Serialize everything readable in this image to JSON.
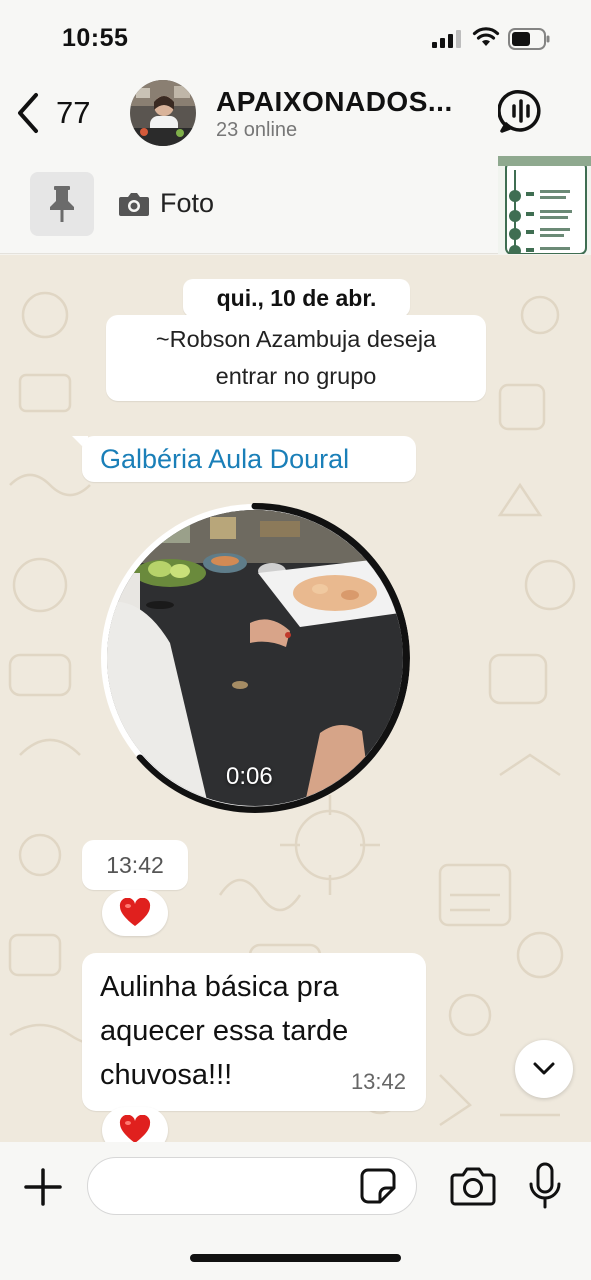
{
  "status_bar": {
    "time": "10:55"
  },
  "header": {
    "back_count": "77",
    "group_name": "APAIXONADOS...",
    "online_status": "23 online"
  },
  "pinned": {
    "label": "Foto"
  },
  "chat": {
    "date_separator": "qui., 10 de abr.",
    "system_message_line1": "~Robson Azambuja deseja",
    "system_message_line2": "entrar no grupo",
    "sender_name": "Galbéria Aula Doural",
    "video_duration": "0:06",
    "video_time": "13:42",
    "reaction_1": "❤️",
    "text_message_line1": "Aulinha básica pra",
    "text_message_line2": "aquecer essa tarde",
    "text_message_line3": "chuvosa!!!",
    "text_message_time": "13:42",
    "reaction_2": "❤️"
  },
  "input": {
    "placeholder": ""
  },
  "colors": {
    "accent_link": "#1a7fb8",
    "chat_background": "#efe9dd",
    "bubble": "#ffffff"
  },
  "icons": [
    "back-chevron",
    "voice-chat",
    "pin",
    "camera",
    "chevron-down",
    "plus",
    "sticker",
    "microphone"
  ]
}
